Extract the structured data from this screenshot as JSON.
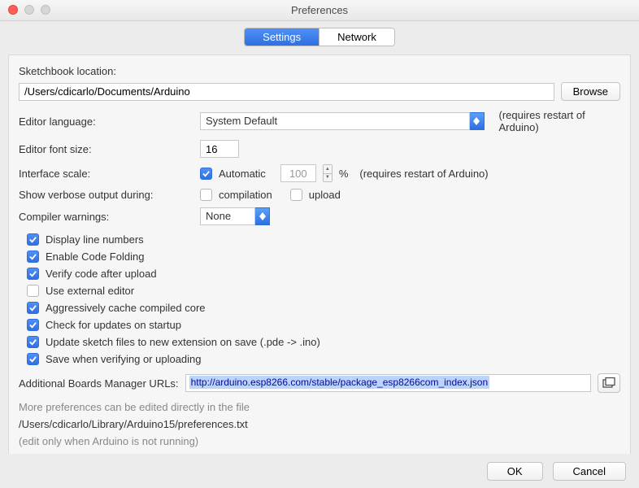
{
  "window": {
    "title": "Preferences"
  },
  "tabs": {
    "settings": "Settings",
    "network": "Network"
  },
  "sketchbook": {
    "label": "Sketchbook location:",
    "path": "/Users/cdicarlo/Documents/Arduino",
    "browse": "Browse"
  },
  "language": {
    "label": "Editor language:",
    "value": "System Default",
    "hint": "(requires restart of Arduino)"
  },
  "fontsize": {
    "label": "Editor font size:",
    "value": "16"
  },
  "scale": {
    "label": "Interface scale:",
    "auto_label": "Automatic",
    "value": "100",
    "percent": "%",
    "hint": "(requires restart of Arduino)"
  },
  "verbose": {
    "label": "Show verbose output during:",
    "compilation": "compilation",
    "upload": "upload"
  },
  "compiler": {
    "label": "Compiler warnings:",
    "value": "None"
  },
  "checks": {
    "display_line_numbers": "Display line numbers",
    "enable_code_folding": "Enable Code Folding",
    "verify_after_upload": "Verify code after upload",
    "use_external_editor": "Use external editor",
    "aggressive_cache": "Aggressively cache compiled core",
    "check_updates": "Check for updates on startup",
    "update_ext": "Update sketch files to new extension on save (.pde -> .ino)",
    "save_on_verify": "Save when verifying or uploading"
  },
  "boards_url": {
    "label": "Additional Boards Manager URLs:",
    "value": "http://arduino.esp8266.com/stable/package_esp8266com_index.json"
  },
  "footer": {
    "line1": "More preferences can be edited directly in the file",
    "path": "/Users/cdicarlo/Library/Arduino15/preferences.txt",
    "line2": "(edit only when Arduino is not running)"
  },
  "buttons": {
    "ok": "OK",
    "cancel": "Cancel"
  }
}
